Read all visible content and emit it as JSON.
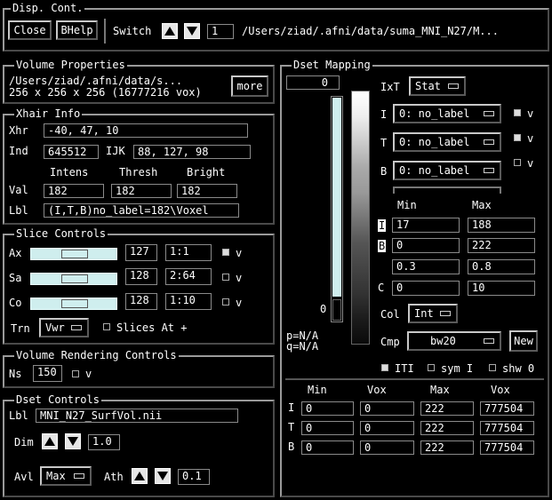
{
  "disp_cont": {
    "title": "Disp. Cont.",
    "close_label": "Close",
    "bhelp_label": "BHelp",
    "switch_label": "Switch",
    "switch_value": "1",
    "path": "/Users/ziad/.afni/data/suma_MNI_N27/M..."
  },
  "volume_properties": {
    "title": "Volume Properties",
    "line1": "/Users/ziad/.afni/data/s...",
    "line2": "256 x 256 x 256 (16777216 vox)",
    "more_label": "more"
  },
  "xhair_info": {
    "title": "Xhair Info",
    "xhr_label": "Xhr",
    "xhr_value": "-40, 47, 10",
    "ind_label": "Ind",
    "ind_value": "645512",
    "ijk_label": "IJK",
    "ijk_value": "88, 127, 98",
    "col_headers": [
      "Intens",
      "Thresh",
      "Bright"
    ],
    "val_label": "Val",
    "values": [
      "182",
      "182",
      "182"
    ],
    "lbl_label": "Lbl",
    "lbl_value": "(I,T,B)no_label=182\\Voxel"
  },
  "slice_controls": {
    "title": "Slice Controls",
    "rows": [
      {
        "label": "Ax",
        "slice": "127",
        "ratio": "1:1",
        "checked": true,
        "v": "v",
        "position": 0.5
      },
      {
        "label": "Sa",
        "slice": "128",
        "ratio": "2:64",
        "checked": false,
        "v": "v",
        "position": 0.5
      },
      {
        "label": "Co",
        "slice": "128",
        "ratio": "1:10",
        "checked": false,
        "v": "v",
        "position": 0.5
      }
    ],
    "trn_label": "Trn",
    "trn_value": "Vwr",
    "slices_at_label": "Slices At +"
  },
  "volume_rendering": {
    "title": "Volume Rendering Controls",
    "ns_label": "Ns",
    "ns_value": "150",
    "v": "v"
  },
  "dset_controls": {
    "title": "Dset Controls",
    "lbl_label": "Lbl",
    "lbl_value": "MNI_N27_SurfVol.nii",
    "dim_label": "Dim",
    "dim_value": "1.0",
    "avl_label": "Avl",
    "avl_value": "Max",
    "ath_label": "Ath",
    "ath_value": "0.1"
  },
  "dset_mapping": {
    "title": "Dset Mapping",
    "bar_top_value": "0",
    "bar_bottom_value": "0",
    "p_label": "p=N/A",
    "q_label": "q=N/A",
    "ixt_label": "IxT",
    "ixt_value": "Stat",
    "i_label": "I",
    "i_value": "0: no_label",
    "t_label": "T",
    "t_value": "0: no_label",
    "b_label": "B",
    "b_value": "0: no_label",
    "v": "v",
    "min_header": "Min",
    "max_header": "Max",
    "range_rows": [
      {
        "label": "I",
        "min": "17",
        "max": "188"
      },
      {
        "label": "B",
        "min": "0",
        "max": "222"
      },
      {
        "label": "",
        "min": "0.3",
        "max": "0.8"
      },
      {
        "label": "C",
        "min": "0",
        "max": "10"
      }
    ],
    "col_label": "Col",
    "col_value": "Int",
    "cmp_label": "Cmp",
    "cmp_value": "bw20",
    "new_label": "New",
    "iti_label": "ITI",
    "sym_label": "sym I",
    "shw_label": "shw 0",
    "table": {
      "headers": [
        "Min",
        "Vox",
        "Max",
        "Vox"
      ],
      "rows": [
        {
          "label": "I",
          "cells": [
            "0",
            "0",
            "222",
            "777504"
          ]
        },
        {
          "label": "T",
          "cells": [
            "0",
            "0",
            "222",
            "777504"
          ]
        },
        {
          "label": "B",
          "cells": [
            "0",
            "0",
            "222",
            "777504"
          ]
        }
      ]
    }
  }
}
